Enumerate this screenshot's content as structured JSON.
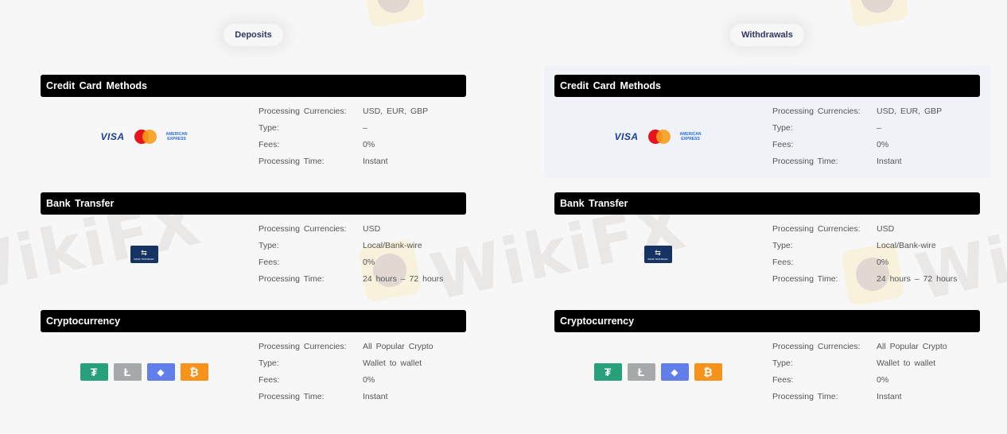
{
  "watermark": {
    "text": "WikiFX"
  },
  "columns": [
    {
      "title": "Deposits",
      "sections": [
        {
          "heading": "Credit Card Methods",
          "icons": {
            "visa": "VISA",
            "mastercard": "mastercard-icon",
            "amex_line1": "AMERICAN",
            "amex_line2": "EXPRESS"
          },
          "rows": [
            {
              "label": "Processing Currencies:",
              "value": "USD, EUR, GBP"
            },
            {
              "label": "Type:",
              "value": "–"
            },
            {
              "label": "Fees:",
              "value": "0%"
            },
            {
              "label": "Processing Time:",
              "value": "Instant"
            }
          ]
        },
        {
          "heading": "Bank Transfer",
          "icons": {
            "bank_glyph": "⇆",
            "bank_label": "BANK TRANSFER"
          },
          "rows": [
            {
              "label": "Processing Currencies:",
              "value": "USD"
            },
            {
              "label": "Type:",
              "value": "Local/Bank-wire"
            },
            {
              "label": "Fees:",
              "value": "0%"
            },
            {
              "label": "Processing Time:",
              "value": "24 hours – 72 hours"
            }
          ]
        },
        {
          "heading": "Cryptocurrency",
          "icons": {
            "tether": "₮",
            "litecoin": "Ł",
            "ethereum": "◆",
            "bitcoin": "₿"
          },
          "rows": [
            {
              "label": "Processing Currencies:",
              "value": "All Popular Crypto"
            },
            {
              "label": "Type:",
              "value": "Wallet to wallet"
            },
            {
              "label": "Fees:",
              "value": "0%"
            },
            {
              "label": "Processing Time:",
              "value": "Instant"
            }
          ]
        }
      ]
    },
    {
      "title": "Withdrawals",
      "sections": [
        {
          "heading": "Credit Card Methods",
          "icons": {
            "visa": "VISA",
            "mastercard": "mastercard-icon",
            "amex_line1": "AMERICAN",
            "amex_line2": "EXPRESS"
          },
          "rows": [
            {
              "label": "Processing Currencies:",
              "value": "USD, EUR, GBP"
            },
            {
              "label": "Type:",
              "value": "–"
            },
            {
              "label": "Fees:",
              "value": "0%"
            },
            {
              "label": "Processing Time:",
              "value": "Instant"
            }
          ]
        },
        {
          "heading": "Bank Transfer",
          "icons": {
            "bank_glyph": "⇆",
            "bank_label": "BANK TRANSFER"
          },
          "rows": [
            {
              "label": "Processing Currencies:",
              "value": "USD"
            },
            {
              "label": "Type:",
              "value": "Local/Bank-wire"
            },
            {
              "label": "Fees:",
              "value": "0%"
            },
            {
              "label": "Processing Time:",
              "value": "24 hours – 72 hours"
            }
          ]
        },
        {
          "heading": "Cryptocurrency",
          "icons": {
            "tether": "₮",
            "litecoin": "Ł",
            "ethereum": "◆",
            "bitcoin": "₿"
          },
          "rows": [
            {
              "label": "Processing Currencies:",
              "value": "All Popular Crypto"
            },
            {
              "label": "Type:",
              "value": "Wallet to wallet"
            },
            {
              "label": "Fees:",
              "value": "0%"
            },
            {
              "label": "Processing Time:",
              "value": "Instant"
            }
          ]
        }
      ]
    }
  ],
  "colors": {
    "title": "#2f3565",
    "header_bg": "#000000",
    "tether": "#26a17b",
    "litecoin": "#a6a9aa",
    "ethereum": "#627eea",
    "bitcoin": "#f7931a",
    "bank": "#163463"
  }
}
